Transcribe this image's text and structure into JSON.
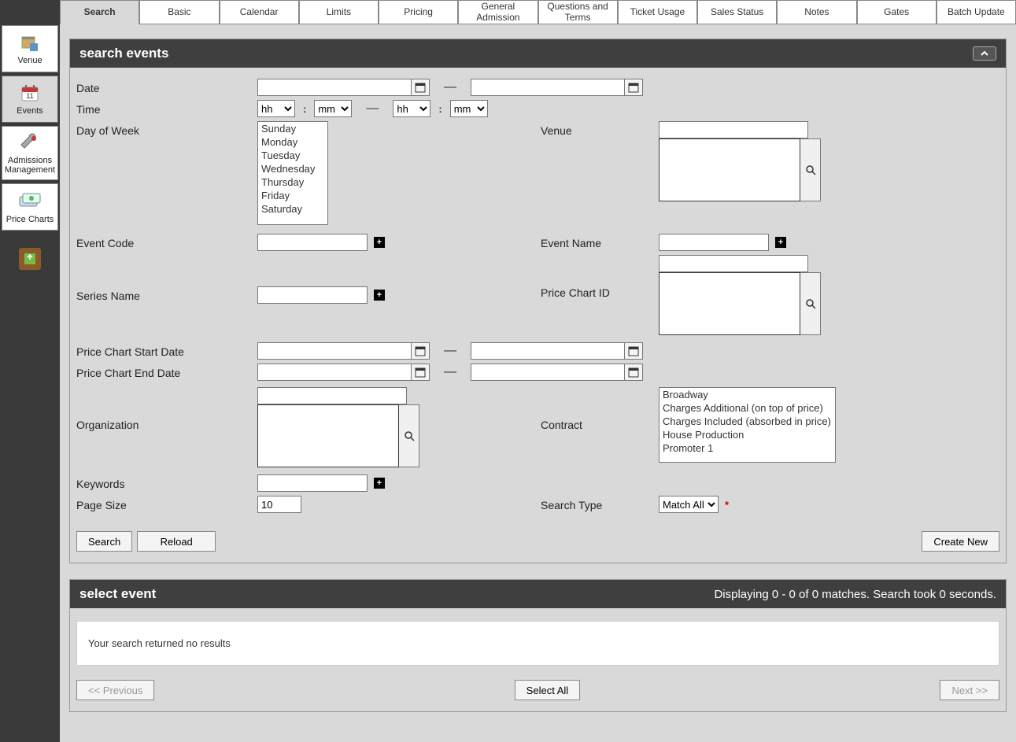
{
  "sidebar": {
    "items": [
      {
        "label": "Venue"
      },
      {
        "label": "Events"
      },
      {
        "label": "Admissions Management"
      },
      {
        "label": "Price Charts"
      }
    ]
  },
  "tabs": [
    "Search",
    "Basic",
    "Calendar",
    "Limits",
    "Pricing",
    "General Admission",
    "Questions and Terms",
    "Ticket Usage",
    "Sales Status",
    "Notes",
    "Gates",
    "Batch Update"
  ],
  "panel1": {
    "title": "search events"
  },
  "form": {
    "date_label": "Date",
    "time_label": "Time",
    "dow_label": "Day of Week",
    "venue_label": "Venue",
    "event_code_label": "Event Code",
    "event_name_label": "Event Name",
    "series_label": "Series Name",
    "price_chart_id_label": "Price Chart ID",
    "pc_start_label": "Price Chart Start Date",
    "pc_end_label": "Price Chart End Date",
    "org_label": "Organization",
    "contract_label": "Contract",
    "keywords_label": "Keywords",
    "page_size_label": "Page Size",
    "page_size_value": "10",
    "search_type_label": "Search Type",
    "search_type_value": "Match All",
    "hh": "hh",
    "mm": "mm",
    "dash": "—",
    "days": [
      "Sunday",
      "Monday",
      "Tuesday",
      "Wednesday",
      "Thursday",
      "Friday",
      "Saturday"
    ],
    "contracts": [
      "Broadway",
      "Charges Additional (on top of price)",
      "Charges Included (absorbed in price)",
      "House Production",
      "Promoter 1"
    ]
  },
  "buttons": {
    "search": "Search",
    "reload": "Reload",
    "create_new": "Create New",
    "prev": "<< Previous",
    "next": "Next >>",
    "select_all": "Select All"
  },
  "panel2": {
    "title": "select event",
    "status": "Displaying 0 - 0 of 0 matches. Search took 0 seconds.",
    "no_results": "Your search returned no results"
  }
}
